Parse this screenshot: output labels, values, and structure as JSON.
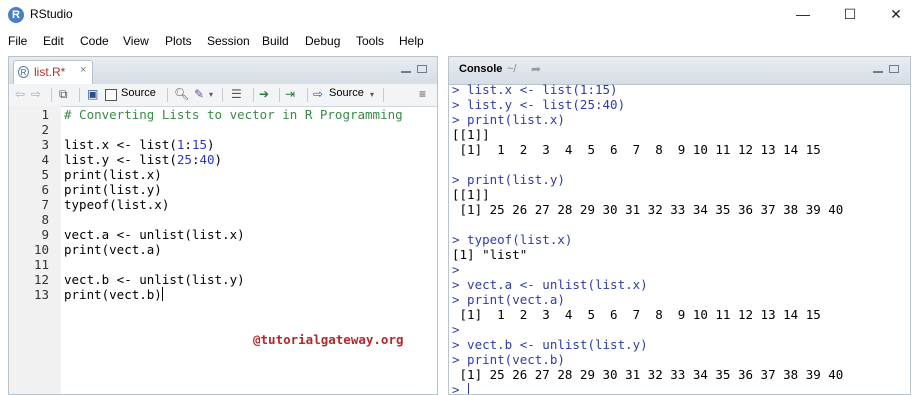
{
  "window": {
    "title": "RStudio",
    "logo_letter": "R",
    "minimize_glyph": "—",
    "maximize_glyph": "☐",
    "close_glyph": "✕"
  },
  "menu": [
    "File",
    "Edit",
    "Code",
    "View",
    "Plots",
    "Session",
    "Build",
    "Debug",
    "Tools",
    "Help"
  ],
  "editor": {
    "tab_label": "list.R*",
    "tab_close": "×",
    "toolbar": {
      "source_on_save_label": "Source",
      "source_button_label": "Source"
    },
    "lines": [
      {
        "n": "1",
        "text": "# Converting Lists to vector in R Programming"
      },
      {
        "n": "2",
        "text": ""
      },
      {
        "n": "3",
        "text": "list.x <- list(1:15)"
      },
      {
        "n": "4",
        "text": "list.y <- list(25:40)"
      },
      {
        "n": "5",
        "text": "print(list.x)"
      },
      {
        "n": "6",
        "text": "print(list.y)"
      },
      {
        "n": "7",
        "text": "typeof(list.x)"
      },
      {
        "n": "8",
        "text": ""
      },
      {
        "n": "9",
        "text": "vect.a <- unlist(list.x)"
      },
      {
        "n": "10",
        "text": "print(vect.a)"
      },
      {
        "n": "11",
        "text": ""
      },
      {
        "n": "12",
        "text": "vect.b <- unlist(list.y)"
      },
      {
        "n": "13",
        "text": "print(vect.b)"
      }
    ],
    "watermark": "@tutorialgateway.org"
  },
  "console": {
    "title": "Console",
    "path": "~/",
    "lines": [
      {
        "kind": "cmd",
        "text": "> list.x <- list(1:15)"
      },
      {
        "kind": "cmd",
        "text": "> list.y <- list(25:40)"
      },
      {
        "kind": "cmd",
        "text": "> print(list.x)"
      },
      {
        "kind": "out",
        "text": "[[1]]"
      },
      {
        "kind": "out",
        "text": " [1]  1  2  3  4  5  6  7  8  9 10 11 12 13 14 15"
      },
      {
        "kind": "out",
        "text": ""
      },
      {
        "kind": "cmd",
        "text": "> print(list.y)"
      },
      {
        "kind": "out",
        "text": "[[1]]"
      },
      {
        "kind": "out",
        "text": " [1] 25 26 27 28 29 30 31 32 33 34 35 36 37 38 39 40"
      },
      {
        "kind": "out",
        "text": ""
      },
      {
        "kind": "cmd",
        "text": "> typeof(list.x)"
      },
      {
        "kind": "out",
        "text": "[1] \"list\""
      },
      {
        "kind": "cmd",
        "text": ">"
      },
      {
        "kind": "cmd",
        "text": "> vect.a <- unlist(list.x)"
      },
      {
        "kind": "cmd",
        "text": "> print(vect.a)"
      },
      {
        "kind": "out",
        "text": " [1]  1  2  3  4  5  6  7  8  9 10 11 12 13 14 15"
      },
      {
        "kind": "cmd",
        "text": ">"
      },
      {
        "kind": "cmd",
        "text": "> vect.b <- unlist(list.y)"
      },
      {
        "kind": "cmd",
        "text": "> print(vect.b)"
      },
      {
        "kind": "out",
        "text": " [1] 25 26 27 28 29 30 31 32 33 34 35 36 37 38 39 40"
      },
      {
        "kind": "cmd",
        "text": ">"
      }
    ]
  },
  "colors": {
    "command_text": "#2f3ca8",
    "comment_text": "#3a8a48",
    "number_text": "#2c36c8",
    "watermark_text": "#b4282c"
  }
}
